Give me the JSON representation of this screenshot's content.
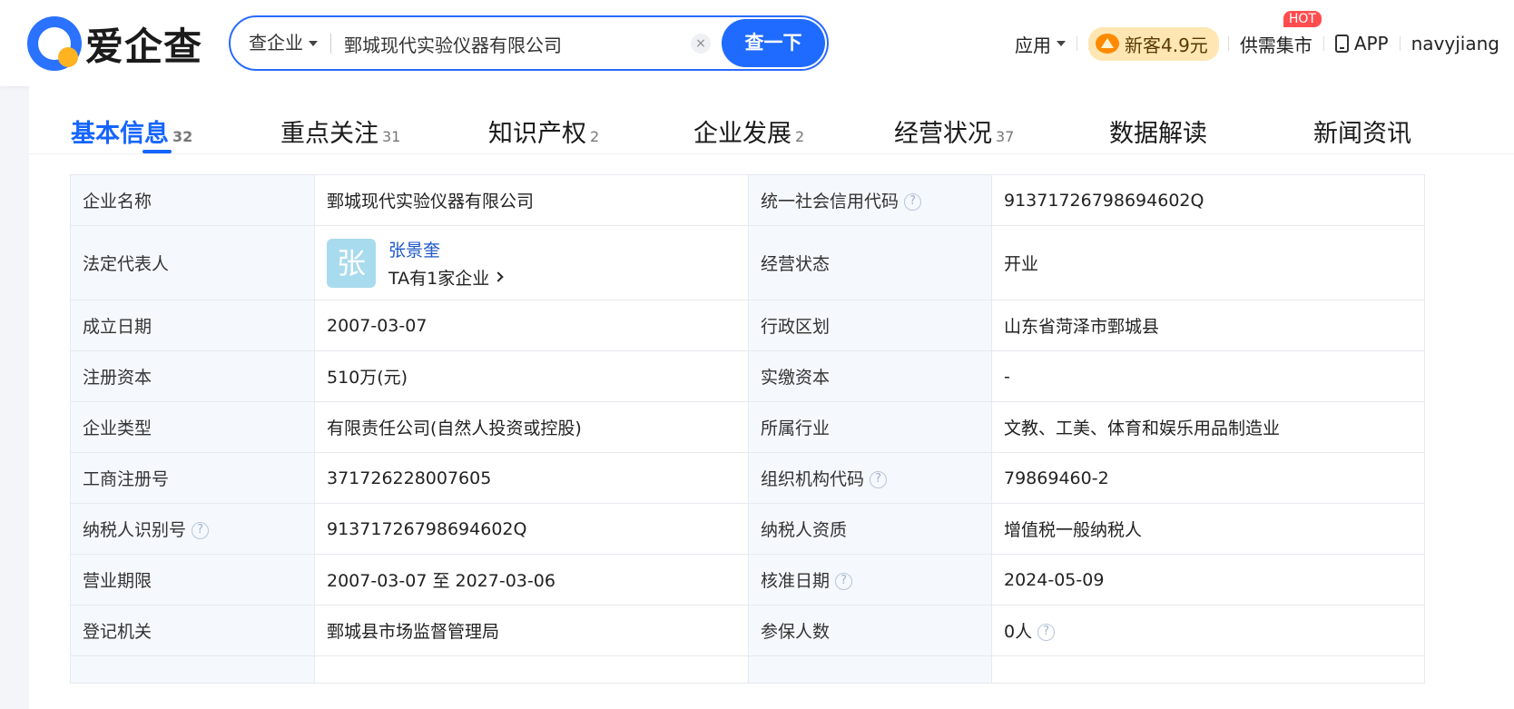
{
  "logo": {
    "text": "爱企查"
  },
  "search": {
    "type_label": "查企业",
    "query": "鄄城现代实验仪器有限公司",
    "clear": "×",
    "button_label": "查一下"
  },
  "nav": {
    "apps": "应用",
    "promo": "新客4.9元",
    "market": "供需集市",
    "hot": "HOT",
    "app": "APP",
    "user": "navyjiang"
  },
  "tabs": [
    {
      "label": "基本信息",
      "count": "32"
    },
    {
      "label": "重点关注",
      "count": "31"
    },
    {
      "label": "知识产权",
      "count": "2"
    },
    {
      "label": "企业发展",
      "count": "2"
    },
    {
      "label": "经营状况",
      "count": "37"
    },
    {
      "label": "数据解读",
      "count": ""
    },
    {
      "label": "新闻资讯",
      "count": ""
    }
  ],
  "info": {
    "rows": [
      {
        "l1": "企业名称",
        "v1": "鄄城现代实验仪器有限公司",
        "l2": "统一社会信用代码",
        "v2": "91371726798694602Q"
      },
      {
        "l1": "法定代表人",
        "rep_avatar": "张",
        "rep_name": "张景奎",
        "rep_sub": "TA有1家企业",
        "l2": "经营状态",
        "v2": "开业"
      },
      {
        "l1": "成立日期",
        "v1": "2007-03-07",
        "l2": "行政区划",
        "v2": "山东省菏泽市鄄城县"
      },
      {
        "l1": "注册资本",
        "v1": "510万(元)",
        "l2": "实缴资本",
        "v2": "-"
      },
      {
        "l1": "企业类型",
        "v1": "有限责任公司(自然人投资或控股)",
        "l2": "所属行业",
        "v2": "文教、工美、体育和娱乐用品制造业"
      },
      {
        "l1": "工商注册号",
        "v1": "371726228007605",
        "l2": "组织机构代码",
        "v2": "79869460-2"
      },
      {
        "l1": "纳税人识别号",
        "v1": "91371726798694602Q",
        "l2": "纳税人资质",
        "v2": "增值税一般纳税人"
      },
      {
        "l1": "营业期限",
        "v1": "2007-03-07 至 2027-03-06",
        "l2": "核准日期",
        "v2": "2024-05-09"
      },
      {
        "l1": "登记机关",
        "v1": "鄄城县市场监督管理局",
        "l2": "参保人数",
        "v2": "0人"
      }
    ]
  },
  "qmark": "?"
}
